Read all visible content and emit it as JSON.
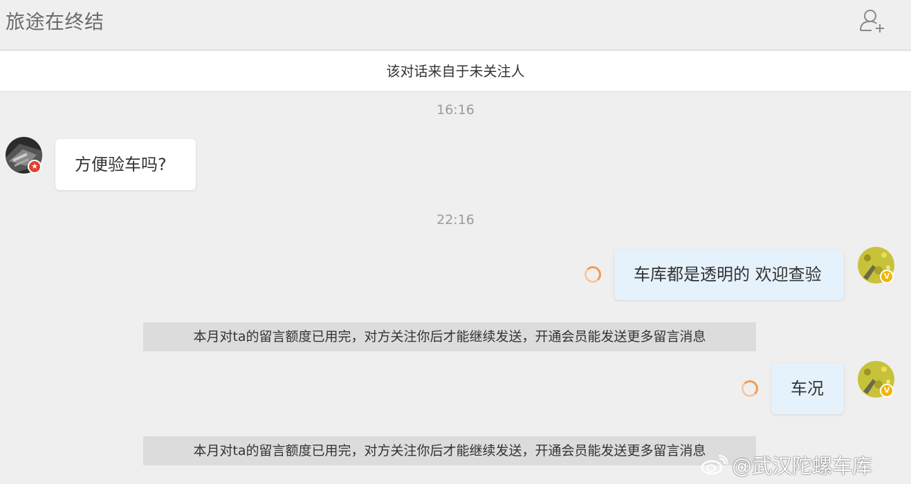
{
  "header": {
    "title": "旅途在终结",
    "add_user_icon": "add-user-icon"
  },
  "notice": {
    "text": "该对话来自于未关注人"
  },
  "messages": [
    {
      "type": "time",
      "text": "16:16"
    },
    {
      "type": "incoming",
      "text": "方便验车吗?",
      "avatar_badge": "red-verified"
    },
    {
      "type": "time",
      "text": "22:16"
    },
    {
      "type": "outgoing",
      "text": "车库都是透明的 欢迎查验",
      "status": "sending",
      "avatar_badge": "gold-verified"
    },
    {
      "type": "system",
      "text": "本月对ta的留言额度已用完，对方关注你后才能继续发送，开通会员能发送更多留言消息"
    },
    {
      "type": "outgoing",
      "text": "车况",
      "status": "sending",
      "avatar_badge": "gold-verified"
    },
    {
      "type": "system",
      "text": "本月对ta的留言额度已用完，对方关注你后才能继续发送，开通会员能发送更多留言消息"
    }
  ],
  "watermark": {
    "text": "@武汉陀螺车库",
    "logo_icon": "weibo-logo-icon"
  },
  "colors": {
    "background": "#efefef",
    "incoming_bubble": "#ffffff",
    "outgoing_bubble": "#e5f1fb",
    "system_bar": "#dcdcdc",
    "verified_red": "#e6402f",
    "verified_gold": "#f4b400",
    "spinner": "#f29b4e"
  }
}
